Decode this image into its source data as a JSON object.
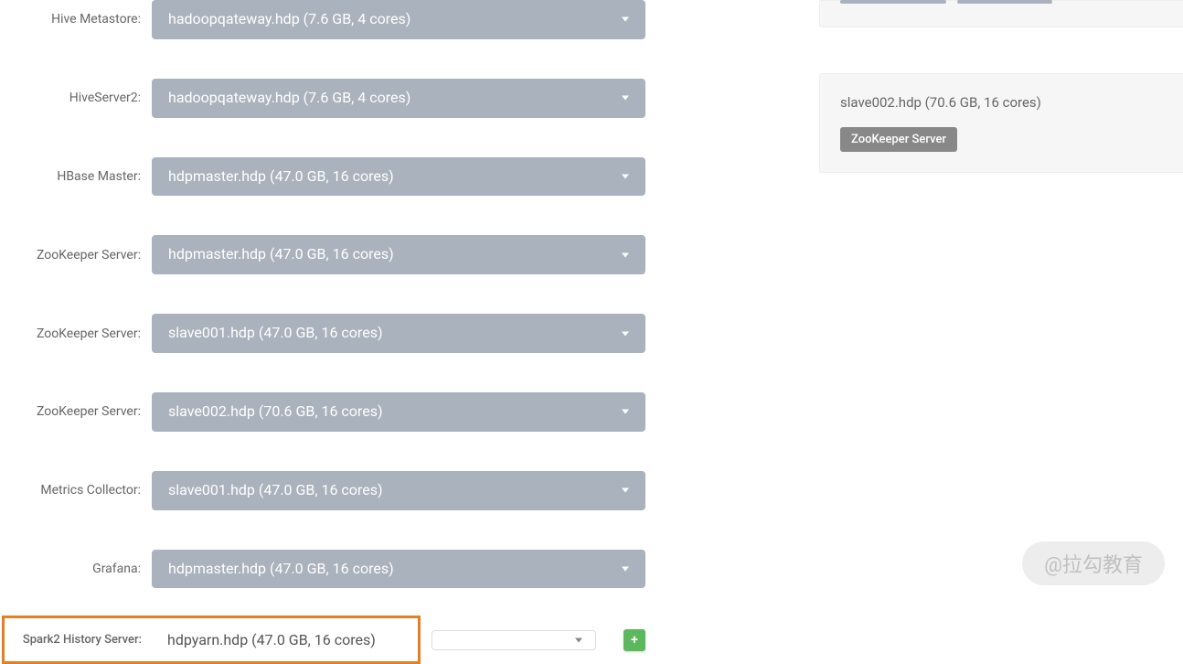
{
  "assignments": [
    {
      "label": "Hive Metastore:",
      "value": "hadoopqateway.hdp (7.6 GB, 4 cores)"
    },
    {
      "label": "HiveServer2:",
      "value": "hadoopqateway.hdp (7.6 GB, 4 cores)"
    },
    {
      "label": "HBase Master:",
      "value": "hdpmaster.hdp (47.0 GB, 16 cores)"
    },
    {
      "label": "ZooKeeper Server:",
      "value": "hdpmaster.hdp (47.0 GB, 16 cores)"
    },
    {
      "label": "ZooKeeper Server:",
      "value": "slave001.hdp (47.0 GB, 16 cores)"
    },
    {
      "label": "ZooKeeper Server:",
      "value": "slave002.hdp (70.6 GB, 16 cores)"
    },
    {
      "label": "Metrics Collector:",
      "value": "slave001.hdp (47.0 GB, 16 cores)"
    },
    {
      "label": "Grafana:",
      "value": "hdpmaster.hdp (47.0 GB, 16 cores)"
    }
  ],
  "highlighted": {
    "label": "Spark2 History Server:",
    "value": "hdpyarn.hdp (47.0 GB, 16 cores)"
  },
  "add_icon": "+",
  "side_card": {
    "title": "slave002.hdp (70.6 GB, 16 cores)",
    "badge": "ZooKeeper Server"
  },
  "watermark": "@拉勾教育"
}
